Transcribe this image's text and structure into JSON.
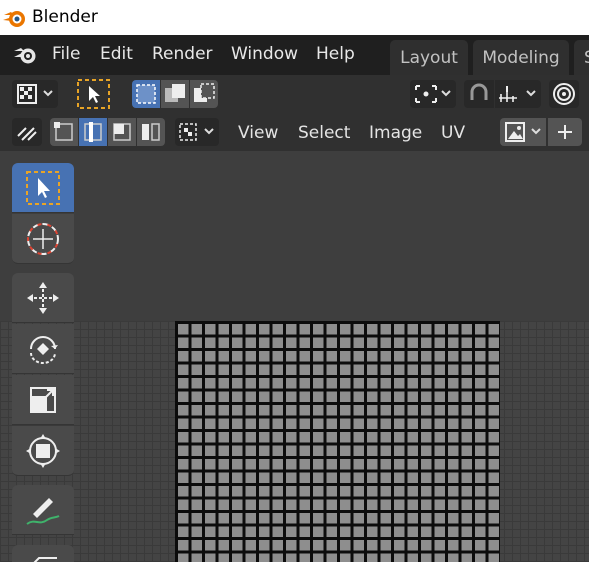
{
  "window": {
    "title": "Blender",
    "logo_icon": "blender-logo-icon"
  },
  "menubar": {
    "logo_icon": "blender-logo-icon",
    "items": [
      "File",
      "Edit",
      "Render",
      "Window",
      "Help"
    ],
    "workspace_tabs": [
      "Layout",
      "Modeling",
      "S"
    ]
  },
  "header_row1": {
    "editor_type_icon": "uv-editor-icon",
    "select_mode_icon": "cursor-select-icon",
    "selection_modes": [
      "select-new-icon",
      "select-extend-icon",
      "select-subtract-icon"
    ],
    "pivot_icon": "pivot-point-icon",
    "snap_icon": "snap-magnet-icon",
    "snap_target_icon": "snap-increment-icon",
    "proportional_icon": "proportional-edit-icon"
  },
  "header_row2": {
    "sync_icon": "uv-sync-selection-icon",
    "element_modes": [
      "vertex-mode-icon",
      "edge-mode-icon",
      "face-mode-icon",
      "island-mode-icon"
    ],
    "sticky_icon": "sticky-selection-icon",
    "menus": [
      "View",
      "Select",
      "Image",
      "UV"
    ],
    "image_browse_icon": "image-browse-icon",
    "new_icon": "plus-icon"
  },
  "toolbar": {
    "tools": [
      {
        "name": "select-box-tool",
        "icon": "select-box-icon",
        "active": true
      },
      {
        "name": "cursor-tool",
        "icon": "cursor-3d-icon",
        "active": false
      },
      {
        "name": "move-tool",
        "icon": "move-icon",
        "active": false
      },
      {
        "name": "rotate-tool",
        "icon": "rotate-icon",
        "active": false
      },
      {
        "name": "scale-tool",
        "icon": "scale-icon",
        "active": false
      },
      {
        "name": "transform-tool",
        "icon": "transform-icon",
        "active": false
      },
      {
        "name": "annotate-tool",
        "icon": "annotate-pen-icon",
        "active": false
      }
    ]
  },
  "colors": {
    "accent_blue": "#4772b3",
    "menubar_bg": "#1f1f1f",
    "header_bg": "#303030",
    "editor_bg": "#3e3e3e",
    "select_dash": "#e8a426"
  }
}
